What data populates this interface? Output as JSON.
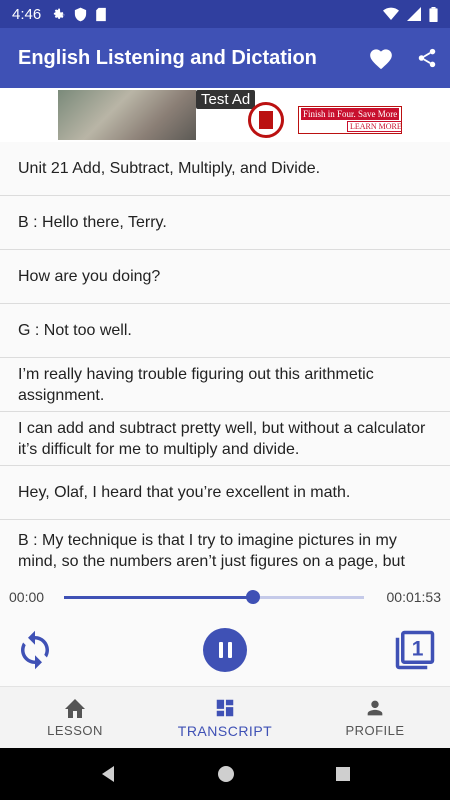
{
  "status_bar": {
    "time": "4:46",
    "icons": [
      "gear-icon",
      "shield-icon",
      "sd-card-icon"
    ],
    "right_icons": [
      "wifi-icon",
      "signal-icon",
      "battery-icon"
    ]
  },
  "app_bar": {
    "title": "English Listening and Dictation",
    "actions": [
      "heart-icon",
      "share-icon"
    ]
  },
  "ad": {
    "label": "Test Ad",
    "banner_text": "Finish in Four. Save More",
    "cta": "LEARN MORE",
    "info": "i",
    "close": "✕"
  },
  "transcript": {
    "lines": [
      "Unit 21 Add, Subtract, Multiply, and Divide.",
      "B : Hello there, Terry.",
      "How are you doing?",
      "G : Not too well.",
      "I’m really having trouble figuring out this arithmetic assignment.",
      "I can add and subtract pretty well, but without a calculator it’s difficult for me to multiply and divide.",
      "Hey, Olaf, I heard that you’re excellent in math.",
      "B : My technique is that I try to imagine pictures in my mind, so the numbers aren’t just figures on a page, but something I can apply to real life."
    ]
  },
  "player": {
    "elapsed": "00:00",
    "duration": "00:01:53",
    "progress_fraction": 0.63,
    "copy_badge": "1"
  },
  "bottom_nav": {
    "items": [
      {
        "label": "LESSON",
        "icon": "home-icon",
        "active": false
      },
      {
        "label": "TRANSCRIPT",
        "icon": "dashboard-icon",
        "active": true
      },
      {
        "label": "PROFILE",
        "icon": "person-icon",
        "active": false
      }
    ]
  },
  "colors": {
    "primary": "#3f51b5",
    "primary_dark": "#303f9f",
    "accent_track": "#c5cae9"
  }
}
